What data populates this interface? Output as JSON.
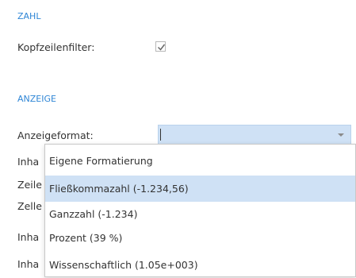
{
  "sections": {
    "zahl": {
      "title": "ZAHL",
      "header_filter_label": "Kopfzeilenfilter:",
      "header_filter_checked": true
    },
    "anzeige": {
      "title": "ANZEIGE",
      "display_format_label": "Anzeigeformat:",
      "display_format_value": "",
      "hidden_labels": [
        "Inha",
        "Zeile",
        "Zelle",
        "Inha",
        "Inha"
      ]
    }
  },
  "dropdown": {
    "options": [
      {
        "label": "Eigene Formatierung",
        "selected": false
      },
      {
        "label": "Fließkommazahl  (-1.234,56)",
        "selected": true
      },
      {
        "label": "Ganzzahl (-1.234)",
        "selected": false
      },
      {
        "label": "Prozent (39 %)",
        "selected": false
      },
      {
        "label": "Wissenschaftlich (1.05e+003)",
        "selected": false
      }
    ]
  },
  "colors": {
    "accent": "#2f86d6",
    "selection": "#cfe1f5"
  }
}
